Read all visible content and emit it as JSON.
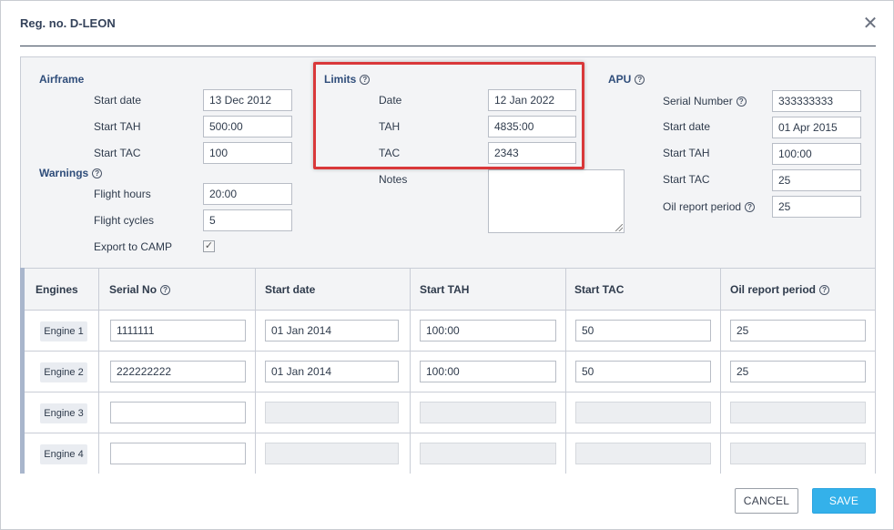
{
  "dialog": {
    "title": "Reg. no. D-LEON",
    "close_glyph": "✕"
  },
  "airframe": {
    "heading": "Airframe",
    "start_date_label": "Start date",
    "start_date_value": "13 Dec 2012",
    "start_tah_label": "Start TAH",
    "start_tah_value": "500:00",
    "start_tac_label": "Start TAC",
    "start_tac_value": "100"
  },
  "warnings": {
    "heading": "Warnings",
    "flight_hours_label": "Flight hours",
    "flight_hours_value": "20:00",
    "flight_cycles_label": "Flight cycles",
    "flight_cycles_value": "5",
    "export_label": "Export to CAMP",
    "export_checked": true
  },
  "limits": {
    "heading": "Limits",
    "date_label": "Date",
    "date_value": "12 Jan 2022",
    "tah_label": "TAH",
    "tah_value": "4835:00",
    "tac_label": "TAC",
    "tac_value": "2343",
    "notes_label": "Notes",
    "notes_value": ""
  },
  "apu": {
    "heading": "APU",
    "serial_label": "Serial Number",
    "serial_value": "333333333",
    "start_date_label": "Start date",
    "start_date_value": "01 Apr 2015",
    "start_tah_label": "Start TAH",
    "start_tah_value": "100:00",
    "start_tac_label": "Start TAC",
    "start_tac_value": "25",
    "oil_label": "Oil report period",
    "oil_value": "25"
  },
  "engines": {
    "headers": [
      "Engines",
      "Serial No",
      "Start date",
      "Start TAH",
      "Start TAC",
      "Oil report period"
    ],
    "rows": [
      {
        "name": "Engine 1",
        "serial": "1111111",
        "start_date": "01 Jan 2014",
        "start_tah": "100:00",
        "start_tac": "50",
        "oil": "25"
      },
      {
        "name": "Engine 2",
        "serial": "222222222",
        "start_date": "01 Jan 2014",
        "start_tah": "100:00",
        "start_tac": "50",
        "oil": "25"
      },
      {
        "name": "Engine 3",
        "serial": "",
        "start_date": "",
        "start_tah": "",
        "start_tac": "",
        "oil": ""
      },
      {
        "name": "Engine 4",
        "serial": "",
        "start_date": "",
        "start_tah": "",
        "start_tac": "",
        "oil": ""
      }
    ]
  },
  "footer": {
    "cancel_label": "CANCEL",
    "save_label": "SAVE"
  },
  "colors": {
    "highlight_border": "#d9383a",
    "save_button": "#34b1ea",
    "heading_text": "#2f4d7a"
  },
  "icons": {
    "help": "question-circle-icon",
    "close": "close-icon",
    "check": "checkmark-icon",
    "resize": "resize-grip-icon"
  }
}
